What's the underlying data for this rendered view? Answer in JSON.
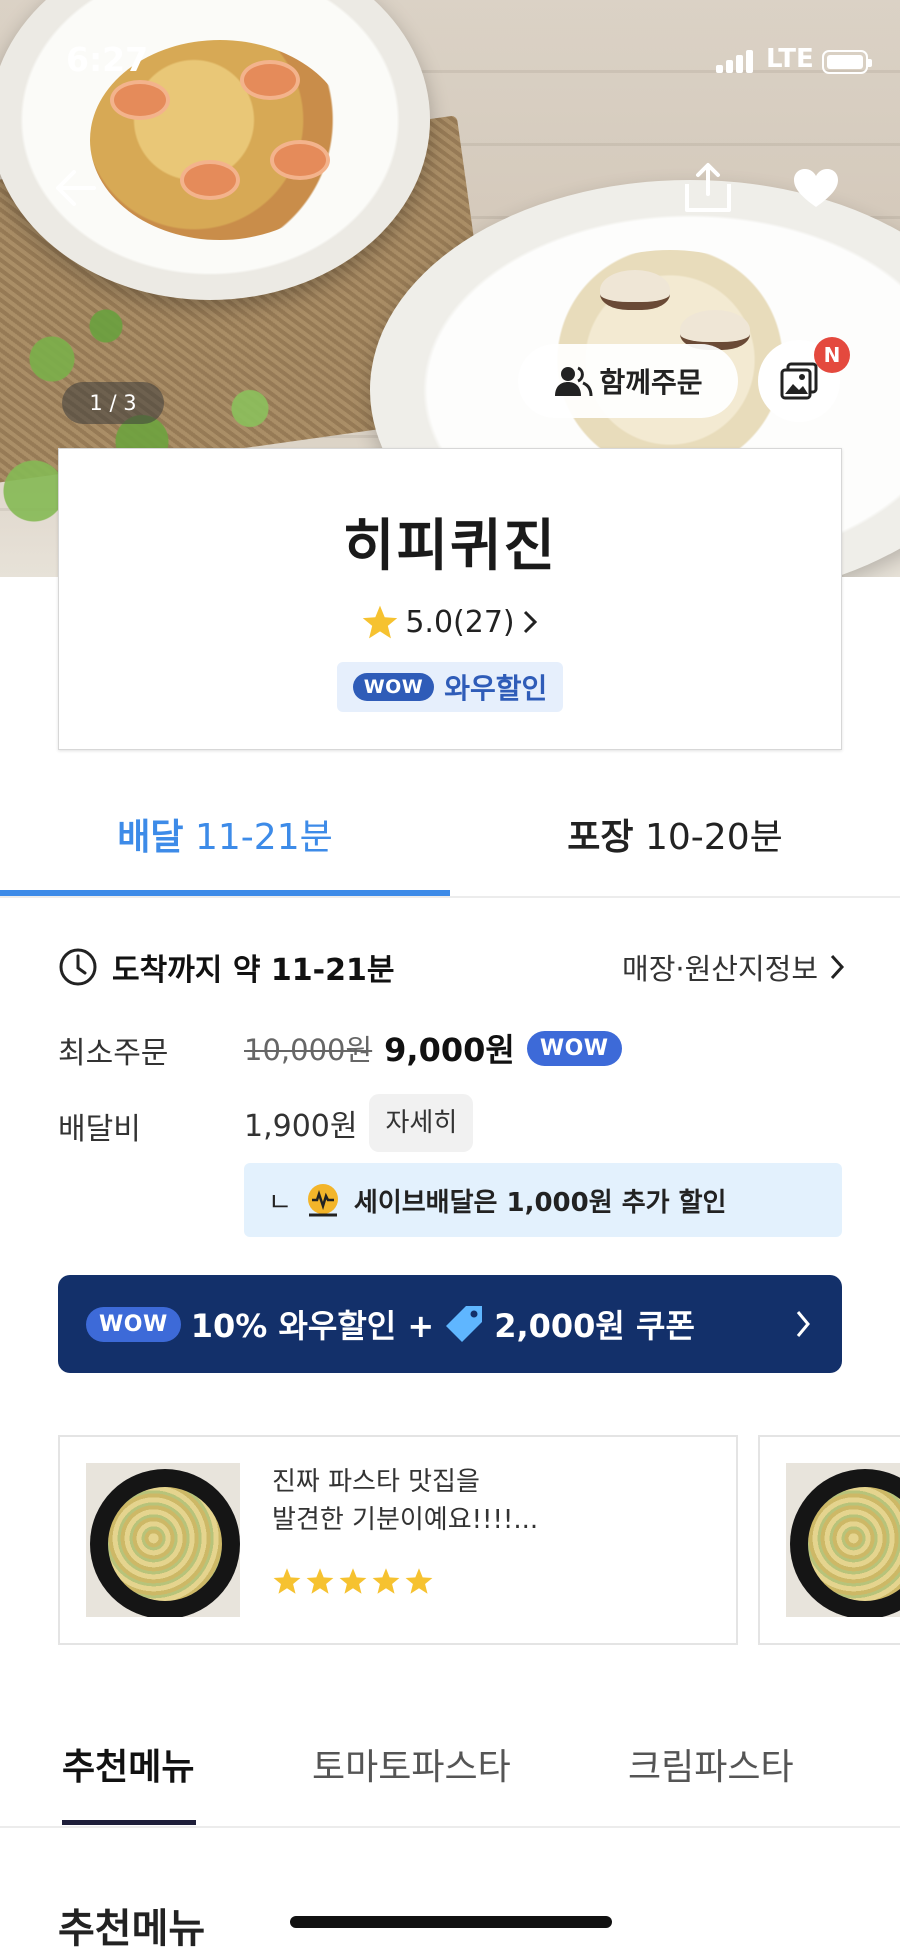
{
  "status_bar": {
    "time": "6:27",
    "network": "LTE"
  },
  "hero": {
    "photo_counter": "1 / 3",
    "together_order_label": "함께주문",
    "gallery_badge": "N"
  },
  "store": {
    "name": "히피퀴진",
    "rating": "5.0(27)",
    "wow_badge": "WOW",
    "wow_discount_label": "와우할인"
  },
  "mode_tabs": [
    {
      "mode": "배달",
      "time": "11-21분",
      "active": true
    },
    {
      "mode": "포장",
      "time": "10-20분",
      "active": false
    }
  ],
  "delivery": {
    "arrival_text": "도착까지 약 11-21분",
    "store_info_link": "매장·원산지정보",
    "min_order_label": "최소주문",
    "min_order_original": "10,000원",
    "min_order_price": "9,000원",
    "min_order_badge": "WOW",
    "fee_label": "배달비",
    "fee_value": "1,900원",
    "fee_detail_button": "자세히",
    "save_prefix": "ㄴ",
    "save_text": "세이브배달은 1,000원 추가 할인"
  },
  "promo": {
    "badge": "WOW",
    "discount_text": "10% 와우할인 +",
    "coupon_text": "2,000원 쿠폰"
  },
  "reviews": [
    {
      "text_line1": "진짜 파스타 맛집을",
      "text_line2": "발견한 기분이예요!!!!...",
      "stars": 5
    }
  ],
  "menu_tabs": [
    {
      "label": "추천메뉴",
      "active": true
    },
    {
      "label": "토마토파스타",
      "active": false
    },
    {
      "label": "크림파스타",
      "active": false
    }
  ],
  "section_title": "추천메뉴",
  "colors": {
    "accent_blue": "#3d8be8",
    "wow_blue": "#2f5cb8",
    "promo_navy": "#13306a",
    "star_yellow": "#f6c230",
    "badge_red": "#e4493e"
  }
}
